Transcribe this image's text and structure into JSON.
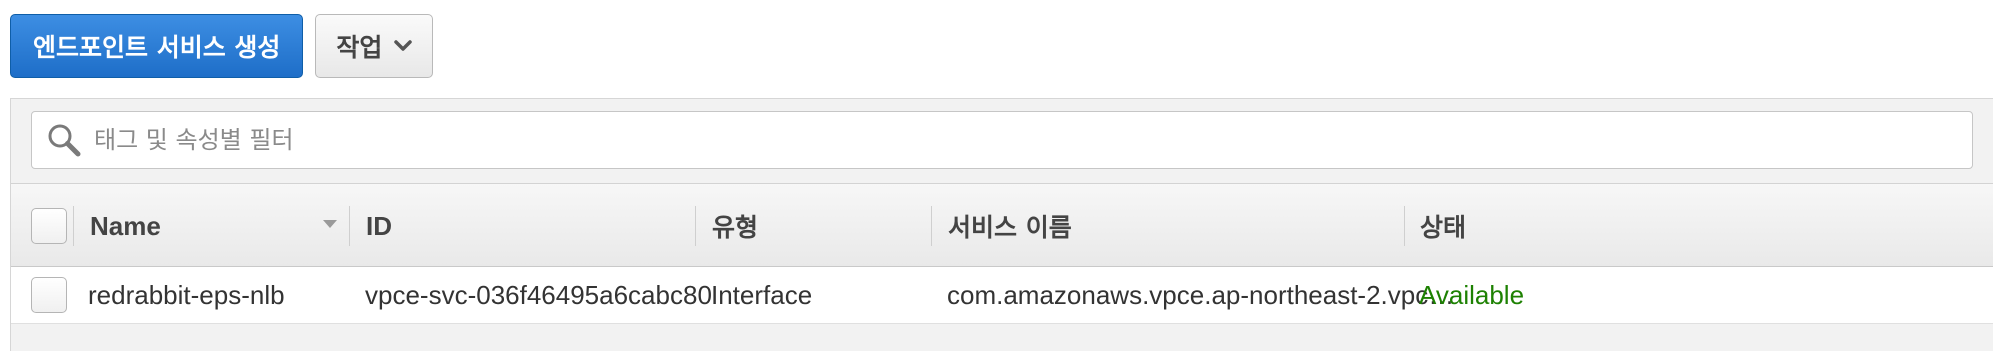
{
  "toolbar": {
    "create_endpoint_service_label": "엔드포인트 서비스 생성",
    "actions_label": "작업"
  },
  "search": {
    "placeholder": "태그 및 속성별 필터",
    "value": ""
  },
  "table": {
    "columns": {
      "name": "Name",
      "id": "ID",
      "type": "유형",
      "service_name": "서비스 이름",
      "status": "상태"
    },
    "rows": [
      {
        "name": "redrabbit-eps-nlb",
        "id": "vpce-svc-036f46495a6cabc80",
        "type": "Interface",
        "service_name": "com.amazonaws.vpce.ap-northeast-2.vpc…",
        "status": "Available"
      }
    ]
  },
  "colors": {
    "primary_button": "#1e6ec8",
    "status_available": "#1d8102"
  },
  "icons": {
    "search": "search-icon",
    "actions_dropdown": "chevron-down-icon",
    "sort": "sort-desc-icon"
  }
}
